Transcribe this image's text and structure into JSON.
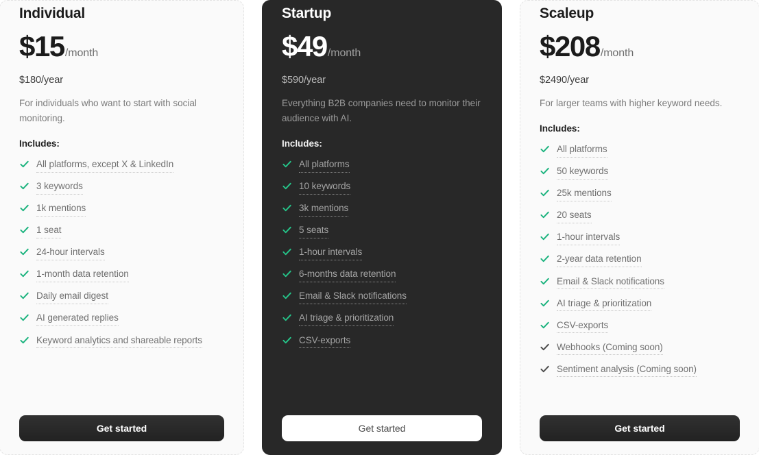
{
  "plans": [
    {
      "id": "individual",
      "theme": "light",
      "name": "Individual",
      "price": "$15",
      "period": "/month",
      "yearly": "$180/year",
      "description": "For individuals who want to start with social monitoring.",
      "includes_label": "Includes:",
      "check_color": "#18b27c",
      "features": [
        {
          "label": "All platforms, except X & LinkedIn",
          "available": true
        },
        {
          "label": "3 keywords",
          "available": true
        },
        {
          "label": "1k mentions",
          "available": true
        },
        {
          "label": "1 seat",
          "available": true
        },
        {
          "label": "24-hour intervals",
          "available": true
        },
        {
          "label": "1-month data retention",
          "available": true
        },
        {
          "label": "Daily email digest",
          "available": true
        },
        {
          "label": "AI generated replies",
          "available": true
        },
        {
          "label": "Keyword analytics and shareable reports",
          "available": true
        }
      ],
      "cta_label": "Get started",
      "cta_style": "dark"
    },
    {
      "id": "startup",
      "theme": "dark",
      "name": "Startup",
      "price": "$49",
      "period": "/month",
      "yearly": "$590/year",
      "description": "Everything B2B companies need to monitor their audience with AI.",
      "includes_label": "Includes:",
      "check_color": "#25c68a",
      "features": [
        {
          "label": "All platforms",
          "available": true
        },
        {
          "label": "10 keywords",
          "available": true
        },
        {
          "label": "3k mentions",
          "available": true
        },
        {
          "label": "5 seats",
          "available": true
        },
        {
          "label": "1-hour intervals",
          "available": true
        },
        {
          "label": "6-months data retention",
          "available": true
        },
        {
          "label": "Email & Slack notifications",
          "available": true
        },
        {
          "label": "AI triage & prioritization",
          "available": true
        },
        {
          "label": "CSV-exports",
          "available": true
        }
      ],
      "cta_label": "Get started",
      "cta_style": "white"
    },
    {
      "id": "scaleup",
      "theme": "light",
      "name": "Scaleup",
      "price": "$208",
      "period": "/month",
      "yearly": "$2490/year",
      "description": "For larger teams with higher keyword needs.",
      "includes_label": "Includes:",
      "check_color": "#18b27c",
      "features": [
        {
          "label": "All platforms",
          "available": true
        },
        {
          "label": "50 keywords",
          "available": true
        },
        {
          "label": "25k mentions",
          "available": true
        },
        {
          "label": "20 seats",
          "available": true
        },
        {
          "label": "1-hour intervals",
          "available": true
        },
        {
          "label": "2-year data retention",
          "available": true
        },
        {
          "label": "Email & Slack notifications",
          "available": true
        },
        {
          "label": "AI triage & prioritization",
          "available": true
        },
        {
          "label": "CSV-exports",
          "available": true
        },
        {
          "label": "Webhooks (Coming soon)",
          "available": false
        },
        {
          "label": "Sentiment analysis (Coming soon)",
          "available": false
        }
      ],
      "cta_label": "Get started",
      "cta_style": "dark"
    }
  ],
  "icons": {
    "check": "check-icon"
  },
  "colors": {
    "check_green": "#18b27c",
    "check_green_dark_card": "#25c68a",
    "check_pending": "#4a4a4a",
    "card_light_bg": "#fafafa",
    "card_dark_bg": "#282828"
  }
}
